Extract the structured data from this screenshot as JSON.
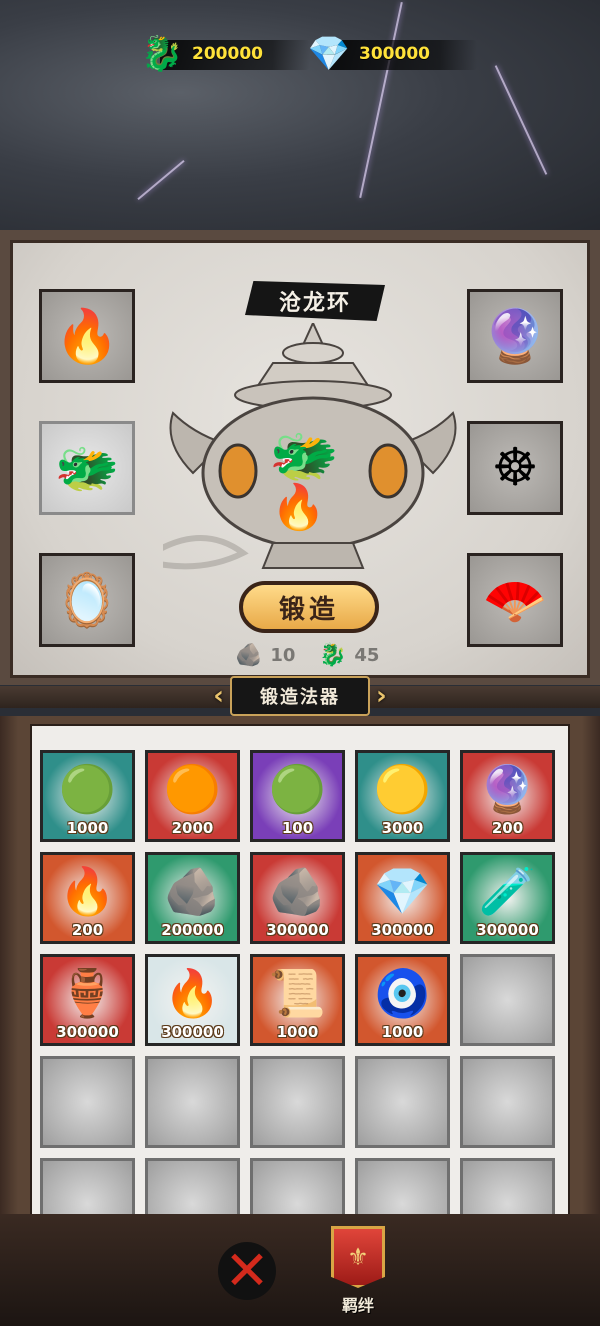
{
  "currencies": [
    {
      "icon": "jade-dragon-icon",
      "glyph": "🐉",
      "amount": "200000"
    },
    {
      "icon": "crystal-shard-icon",
      "glyph": "💎",
      "amount": "300000"
    }
  ],
  "forge": {
    "item_name": "沧龙环",
    "forge_button": "锻造",
    "cost": [
      {
        "icon": "iron-ore-icon",
        "glyph": "🪨",
        "value": "10"
      },
      {
        "icon": "jade-dragon-icon",
        "glyph": "🐉",
        "value": "45"
      }
    ],
    "left_slots": [
      {
        "icon": "fire-amulet-icon",
        "glyph": "🔥"
      },
      {
        "icon": "dragon-ring-icon",
        "glyph": "🐲"
      },
      {
        "icon": "jade-mirror-icon",
        "glyph": "🪞"
      }
    ],
    "right_slots": [
      {
        "icon": "amethyst-crystal-icon",
        "glyph": "🔮"
      },
      {
        "icon": "golden-wheel-icon",
        "glyph": "☸"
      },
      {
        "icon": "silk-fan-icon",
        "glyph": "🪭"
      }
    ],
    "center_glyph": "🐲",
    "flame_glyph": "🔥"
  },
  "section_title": "锻造法器",
  "inventory": [
    {
      "icon": "jade-orb-icon",
      "glyph": "🟢",
      "qty": "1000",
      "bg": "#2f8f8a"
    },
    {
      "icon": "fire-orb-icon",
      "glyph": "🟠",
      "qty": "2000",
      "bg": "#c93a35"
    },
    {
      "icon": "rune-orb-icon",
      "glyph": "🟢",
      "qty": "100",
      "bg": "#7a3fb8"
    },
    {
      "icon": "gold-orb-icon",
      "glyph": "🟡",
      "qty": "3000",
      "bg": "#2f8f8a"
    },
    {
      "icon": "crystal-ball-icon",
      "glyph": "🔮",
      "qty": "200",
      "bg": "#c93a35"
    },
    {
      "icon": "blue-flame-icon",
      "glyph": "🔥",
      "qty": "200",
      "bg": "#d2572e"
    },
    {
      "icon": "dark-stone-icon",
      "glyph": "🪨",
      "qty": "200000",
      "bg": "#2f9a6e"
    },
    {
      "icon": "iron-ore-icon",
      "glyph": "🪨",
      "qty": "300000",
      "bg": "#c93a35"
    },
    {
      "icon": "blue-crystal-icon",
      "glyph": "💎",
      "qty": "300000",
      "bg": "#d2572e"
    },
    {
      "icon": "potion-bottle-icon",
      "glyph": "🧪",
      "qty": "300000",
      "bg": "#2f9a6e"
    },
    {
      "icon": "water-vase-icon",
      "glyph": "🏺",
      "qty": "300000",
      "bg": "#c93a35"
    },
    {
      "icon": "red-flame-icon",
      "glyph": "🔥",
      "qty": "300000",
      "bg": "#d9e6e8"
    },
    {
      "icon": "purple-scroll-icon",
      "glyph": "📜",
      "qty": "1000",
      "bg": "#d2572e"
    },
    {
      "icon": "jade-pendant-icon",
      "glyph": "🧿",
      "qty": "1000",
      "bg": "#d2572e"
    }
  ],
  "empty_slots": 11,
  "bottom": {
    "close_glyph": "✕",
    "bond_glyph": "⚜",
    "bond_label": "羁绊"
  }
}
